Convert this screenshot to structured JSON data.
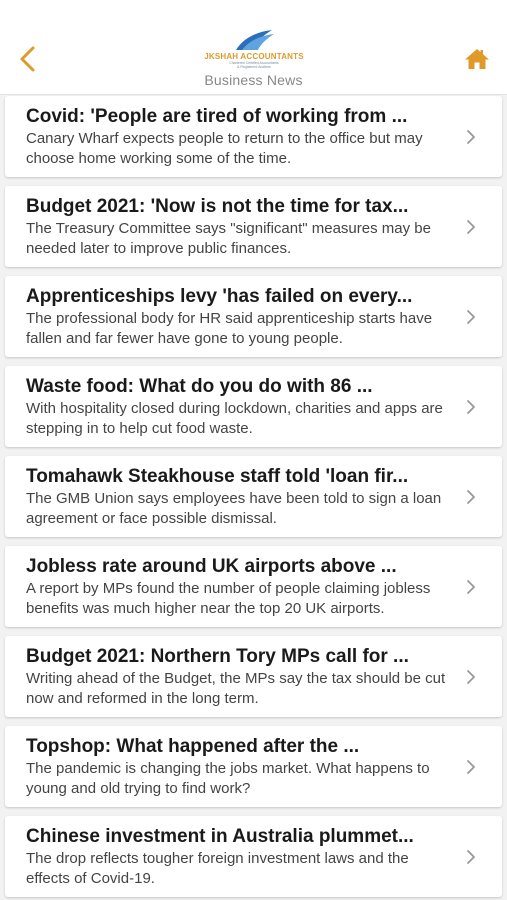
{
  "header": {
    "title": "Business News",
    "logo_name": "JKSHAH ACCOUNTANTS",
    "logo_tagline_1": "Chartered Certified Accountants",
    "logo_tagline_2": "& Registered Auditors",
    "back_icon": "chevron-left-icon",
    "home_icon": "home-icon",
    "accent_color": "#e09a2a"
  },
  "articles": [
    {
      "title": "Covid: 'People are tired of working from ...",
      "desc": "Canary Wharf expects people to return to the office but may choose home working some of the time."
    },
    {
      "title": "Budget 2021: 'Now is not the time for tax...",
      "desc": "The Treasury Committee says \"significant\" measures may be needed later to improve public finances."
    },
    {
      "title": "Apprenticeships levy 'has failed on every...",
      "desc": "The professional body for HR said apprenticeship starts have fallen and far fewer have gone to young people."
    },
    {
      "title": "Waste food: What do you do with 86 ...",
      "desc": "With hospitality closed during lockdown, charities and apps are stepping in to help cut food waste."
    },
    {
      "title": "Tomahawk Steakhouse staff told 'loan fir...",
      "desc": "The GMB Union says employees have been told to sign a loan agreement or face possible dismissal."
    },
    {
      "title": "Jobless rate around UK airports above ...",
      "desc": "A report by MPs found the number of people claiming jobless benefits was much higher near the top 20 UK airports."
    },
    {
      "title": "Budget 2021: Northern Tory MPs call for ...",
      "desc": "Writing ahead of the Budget, the MPs say the tax should be cut now and reformed in the long term."
    },
    {
      "title": "Topshop: What happened after the ...",
      "desc": "The pandemic is changing the jobs market. What happens to young and old trying to find work?"
    },
    {
      "title": "Chinese investment in Australia plummet...",
      "desc": "The drop reflects tougher foreign investment laws and the effects of Covid-19."
    }
  ]
}
